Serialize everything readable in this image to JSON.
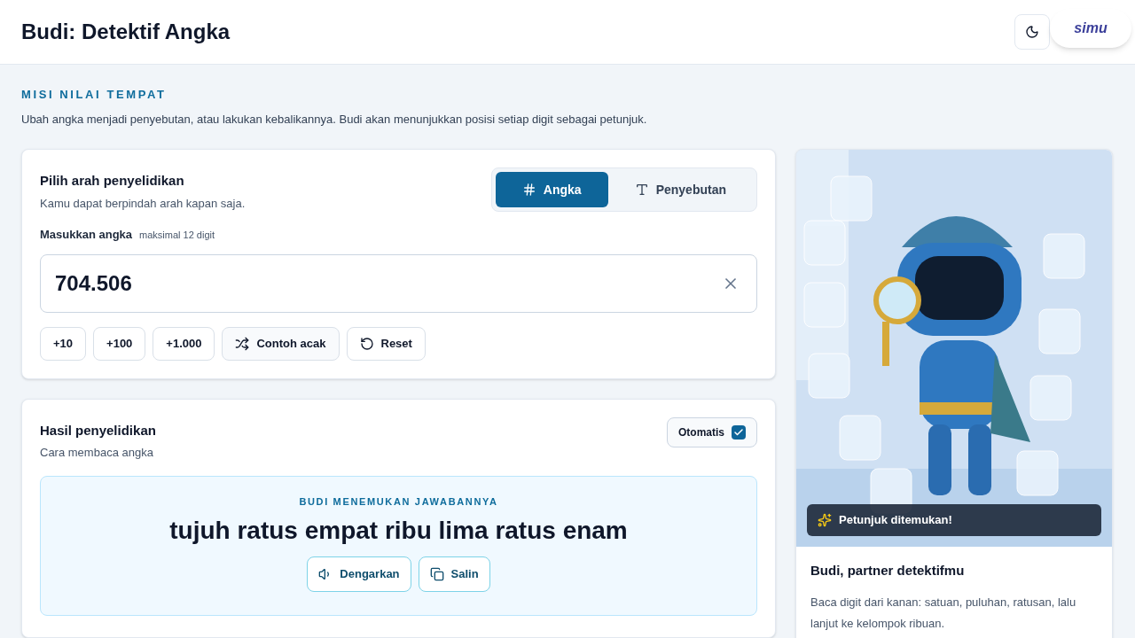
{
  "header": {
    "title": "Budi: Detektif Angka",
    "logo": "simu"
  },
  "intro": {
    "eyebrow": "MISI NILAI TEMPAT",
    "text": "Ubah angka menjadi penyebutan, atau lakukan kebalikannya. Budi akan menunjukkan posisi setiap digit sebagai petunjuk."
  },
  "direction": {
    "title": "Pilih arah penyelidikan",
    "subtitle": "Kamu dapat berpindah arah kapan saja.",
    "modes": [
      {
        "kind": "number",
        "label": "Angka",
        "selected": true
      },
      {
        "kind": "text",
        "label": "Penyebutan",
        "selected": false
      }
    ]
  },
  "input": {
    "label": "Masukkan angka",
    "hint": "maksimal 12 digit",
    "value": "704.506"
  },
  "actions": [
    {
      "kind": "step",
      "label": "+10"
    },
    {
      "kind": "step",
      "label": "+100"
    },
    {
      "kind": "step",
      "label": "+1.000"
    },
    {
      "kind": "random",
      "label": "Contoh acak"
    },
    {
      "kind": "reset",
      "label": "Reset"
    }
  ],
  "result": {
    "title": "Hasil penyelidikan",
    "subtitle": "Cara membaca angka",
    "auto": {
      "label": "Otomatis",
      "checked": true
    },
    "eyebrow": "BUDI MENEMUKAN JAWABANNYA",
    "answer": "tujuh ratus empat ribu lima ratus enam",
    "buttons": [
      {
        "kind": "listen",
        "label": "Dengarkan"
      },
      {
        "kind": "copy",
        "label": "Salin"
      }
    ]
  },
  "partner": {
    "badge": "Petunjuk ditemukan!",
    "title": "Budi, partner detektifmu",
    "text": "Baca digit dari kanan: satuan, puluhan, ratusan, lalu lanjut ke kelompok ribuan."
  }
}
